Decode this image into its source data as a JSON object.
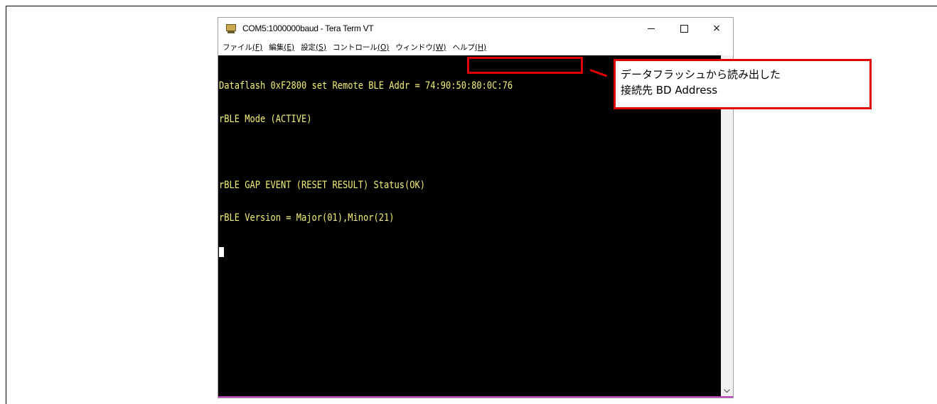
{
  "window": {
    "title": "COM5:1000000baud - Tera Term VT",
    "controls": {
      "minimize": "minimize",
      "maximize": "maximize",
      "close": "×"
    }
  },
  "menu": [
    {
      "label": "ファイル",
      "key": "(F)"
    },
    {
      "label": "編集",
      "key": "(E)"
    },
    {
      "label": "設定",
      "key": "(S)"
    },
    {
      "label": "コントロール",
      "key": "(O)"
    },
    {
      "label": "ウィンドウ",
      "key": "(W)"
    },
    {
      "label": "ヘルプ",
      "key": "(H)"
    }
  ],
  "terminal": {
    "lines": [
      "Dataflash 0xF2800 set Remote BLE Addr = 74:90:50:80:0C:76",
      "rBLE Mode (ACTIVE)",
      "",
      "rBLE GAP EVENT (RESET RESULT) Status(OK)",
      "rBLE Version = Major(01),Minor(21)"
    ]
  },
  "annotation": {
    "line1": "データフラッシュから読み出した",
    "line2": "接続先 BD Address"
  },
  "colors": {
    "terminal_bg": "#000000",
    "terminal_text": "#f5f07a",
    "annotation_border": "#e00000"
  },
  "icons": {
    "app": "tera-term-icon",
    "scroll": "chevron-down-icon"
  }
}
